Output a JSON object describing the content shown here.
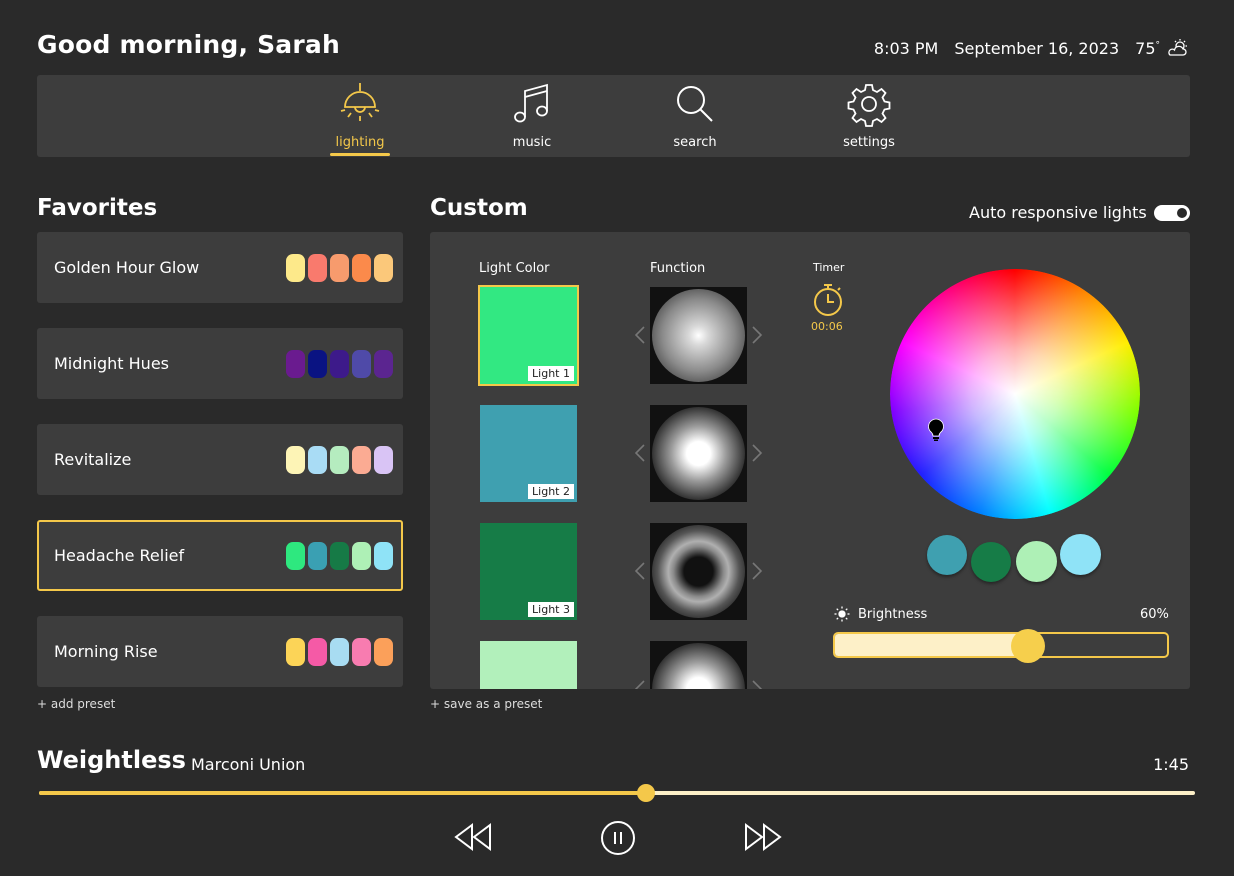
{
  "header": {
    "greeting": "Good morning, Sarah",
    "time": "8:03 PM",
    "date": "September 16, 2023",
    "temperature": "75",
    "weather_icon": "partly-cloudy-icon"
  },
  "nav": {
    "active": "lighting",
    "items": [
      {
        "id": "lighting",
        "label": "lighting",
        "icon": "lamp-icon"
      },
      {
        "id": "music",
        "label": "music",
        "icon": "music-note-icon"
      },
      {
        "id": "search",
        "label": "search",
        "icon": "search-icon"
      },
      {
        "id": "settings",
        "label": "settings",
        "icon": "gear-icon"
      }
    ]
  },
  "favorites": {
    "title": "Favorites",
    "add_label": "+ add preset",
    "selected_index": 3,
    "presets": [
      {
        "name": "Golden Hour Glow",
        "colors": [
          "#fde98a",
          "#f97a6d",
          "#f79b6d",
          "#fb8a4b",
          "#fbc87a"
        ]
      },
      {
        "name": "Midnight Hues",
        "colors": [
          "#6a1b8f",
          "#0a1382",
          "#3d1a8a",
          "#4f4aa8",
          "#5b2590"
        ]
      },
      {
        "name": "Revitalize",
        "colors": [
          "#fdf4b6",
          "#a9dcf5",
          "#b5ecbf",
          "#fbab93",
          "#d9c4f5"
        ]
      },
      {
        "name": "Headache Relief",
        "colors": [
          "#2ee87f",
          "#3aa0b3",
          "#167a46",
          "#aef0b6",
          "#8fe3f7"
        ]
      },
      {
        "name": "Morning Rise",
        "colors": [
          "#fcd457",
          "#f55aa6",
          "#a8dcf2",
          "#f87cb0",
          "#fba05a"
        ]
      }
    ]
  },
  "custom": {
    "title": "Custom",
    "auto_responsive_label": "Auto responsive lights",
    "auto_responsive_on": true,
    "save_label": "+ save as a preset",
    "light_color_header": "Light Color",
    "function_header": "Function",
    "timer_header": "Timer",
    "timer_value": "00:06",
    "lights": [
      {
        "label": "Light 1",
        "color": "#32e882",
        "selected": true,
        "function": "spot"
      },
      {
        "label": "Light 2",
        "color": "#3fa0b0",
        "selected": false,
        "function": "glow"
      },
      {
        "label": "Light 3",
        "color": "#167c47",
        "selected": false,
        "function": "ring"
      },
      {
        "label": "",
        "color": "#b2f0bb",
        "selected": false,
        "function": "glow"
      }
    ],
    "palette": [
      "#3fa0b0",
      "#167c47",
      "#aef0b6",
      "#8fe3f7"
    ],
    "brightness_label": "Brightness",
    "brightness_value": "60%",
    "brightness_fraction": 0.58
  },
  "player": {
    "title": "Weightless",
    "artist": "Marconi Union",
    "elapsed": "1:45",
    "progress": 0.525,
    "controls": [
      "rewind-icon",
      "pause-icon",
      "fast-forward-icon"
    ]
  },
  "colors": {
    "accent": "#f4c84a",
    "panel": "#3d3d3d",
    "background": "#2a2a2a"
  }
}
